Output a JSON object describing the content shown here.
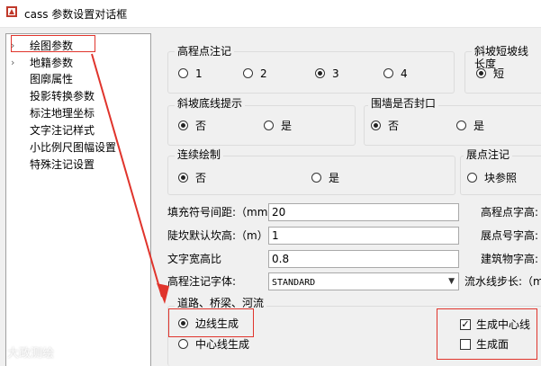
{
  "window": {
    "title": "cass 参数设置对话框"
  },
  "sidebar": {
    "items": [
      {
        "label": "绘图参数",
        "chevron": "›"
      },
      {
        "label": "地籍参数",
        "chevron": "›"
      },
      {
        "label": "图廓属性",
        "chevron": ""
      },
      {
        "label": "投影转换参数",
        "chevron": ""
      },
      {
        "label": "标注地理坐标",
        "chevron": ""
      },
      {
        "label": "文字注记样式",
        "chevron": ""
      },
      {
        "label": "小比例尺图幅设置",
        "chevron": ""
      },
      {
        "label": "特殊注记设置",
        "chevron": ""
      }
    ]
  },
  "groups": {
    "elevation": {
      "title": "高程点注记",
      "options": [
        "1",
        "2",
        "3",
        "4"
      ],
      "selected": "3"
    },
    "slope_short": {
      "title": "斜坡短坡线长度",
      "options": [
        "短"
      ],
      "selected": "短"
    },
    "slope_bottom": {
      "title": "斜坡底线提示",
      "options": [
        "否",
        "是"
      ],
      "selected": "否"
    },
    "wall": {
      "title": "围墙是否封口",
      "options": [
        "否",
        "是"
      ],
      "selected": "否"
    },
    "continuous": {
      "title": "连续绘制",
      "options": [
        "否",
        "是"
      ],
      "selected": "否"
    },
    "exhibit": {
      "title": "展点注记",
      "options": [
        "块参照"
      ],
      "selected": ""
    },
    "road": {
      "title": "道路、桥梁、河流",
      "options": [
        "边线生成",
        "中心线生成"
      ],
      "selected": "边线生成",
      "checks": [
        {
          "label": "生成中心线",
          "checked": true
        },
        {
          "label": "生成面",
          "checked": false
        }
      ]
    }
  },
  "fields": {
    "fill_spacing": {
      "label": "填充符号间距:（mm）",
      "value": "20"
    },
    "pit_height": {
      "label": "陡坎默认坎高:（m）",
      "value": "1"
    },
    "text_ratio": {
      "label": "文字宽高比",
      "value": "0.8"
    },
    "elev_font": {
      "label": "高程注记字体:",
      "value": "STANDARD"
    },
    "elev_size": {
      "label": "高程点字高:"
    },
    "point_size": {
      "label": "展点号字高:"
    },
    "building_size": {
      "label": "建筑物字高:"
    },
    "flow_step": {
      "label": "流水线步长:（m"
    }
  },
  "watermark": "大政测绘",
  "colors": {
    "highlight": "#e0342c"
  }
}
